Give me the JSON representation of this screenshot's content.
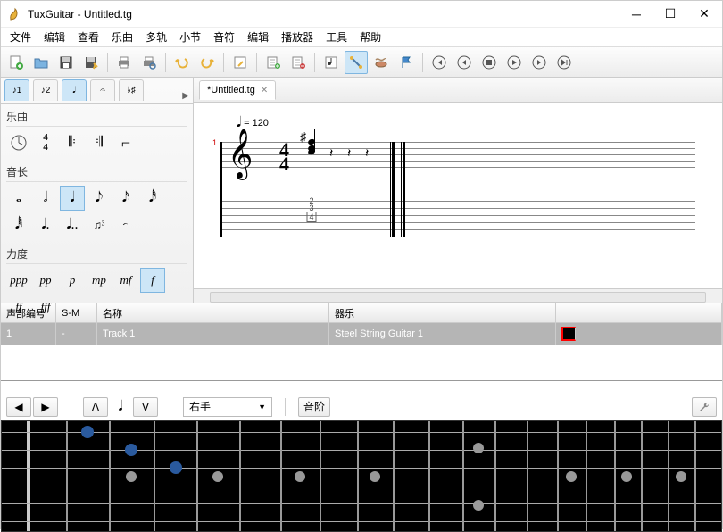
{
  "window": {
    "title": "TuxGuitar - Untitled.tg"
  },
  "menu": [
    "文件",
    "编辑",
    "查看",
    "乐曲",
    "多轨",
    "小节",
    "音符",
    "编辑",
    "播放器",
    "工具",
    "帮助"
  ],
  "toolbar_icons": [
    "new-file",
    "open",
    "save",
    "save-as",
    "print",
    "print-preview",
    "undo",
    "redo",
    "properties",
    "add-track",
    "remove-track",
    "view-score",
    "view-tab",
    "view-mixed",
    "flag",
    "rewind",
    "prev",
    "stop",
    "play",
    "next",
    "end"
  ],
  "side_tabs": [
    "edit1",
    "edit2",
    "note",
    "beam",
    "key"
  ],
  "sections": {
    "song": {
      "title": "乐曲"
    },
    "duration": {
      "title": "音长"
    },
    "dynamics": {
      "title": "力度",
      "values": [
        "ppp",
        "pp",
        "p",
        "mp",
        "mf",
        "f",
        "ff",
        "fff"
      ]
    }
  },
  "doc_tab": {
    "label": "*Untitled.tg"
  },
  "score": {
    "tempo_val": "= 120",
    "time_top": "4",
    "time_bot": "4",
    "measure_no": "1",
    "tab_fret_2": "2",
    "tab_fret_3": "3",
    "tab_fret_4": "4"
  },
  "track_table": {
    "headers": {
      "num": "声部编号",
      "sm": "S-M",
      "name": "名称",
      "instr": "器乐"
    },
    "row": {
      "num": "1",
      "sm": "-",
      "name": "Track 1",
      "instr": "Steel String Guitar 1"
    }
  },
  "bottom": {
    "hand": "右手",
    "scale": "音阶"
  }
}
